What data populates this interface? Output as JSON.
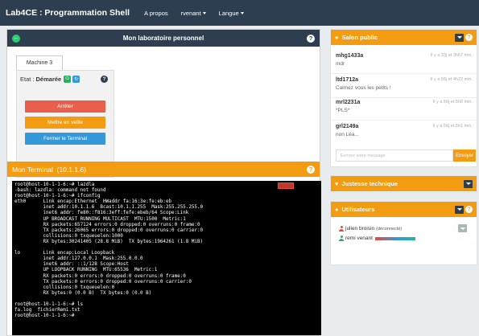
{
  "navbar": {
    "brand": "Lab4CE : Programmation Shell",
    "links": [
      "A propos",
      "rvenant",
      "Langue"
    ]
  },
  "lab": {
    "title": "Mon laboratoire personnel",
    "tab": "Machine 3",
    "state_label": "Etat :",
    "state_value": "Démarée",
    "buttons": {
      "stop": "Arrêter",
      "sleep": "Mettre en veille",
      "close": "Fermer le Terminal"
    },
    "colors": {
      "stop": "#e8604c",
      "sleep": "#f39c12",
      "close": "#3498db",
      "header": "#2c3e50"
    }
  },
  "terminal": {
    "title": "Mon Terminal",
    "ip": "(10.1.1.6)",
    "lines": [
      "root@host-10-1-1-6:~# lazdla",
      "-bash: lazdla: command not found",
      "root@host-10-1-1-6:~# ifconfig",
      "eth0      Link encap:Ethernet  HWaddr fa:16:3e:fe:eb:eb",
      "          inet addr:10.1.1.6  Bcast:10.1.1.255  Mask:255.255.255.0",
      "          inet6 addr: fe80::f816:3eff:fefe:ebeb/64 Scope:Link",
      "          UP BROADCAST RUNNING MULTICAST  MTU:1500  Metric:1",
      "          RX packets:657124 errors:0 dropped:0 overruns:0 frame:0",
      "          TX packets:26065 errors:0 dropped:0 overruns:0 carrier:0",
      "          collisions:0 txqueuelen:1000",
      "          RX bytes:30241405 (28.8 MiB)  TX bytes:1964261 (1.8 MiB)",
      "",
      "lo        Link encap:Local Loopback",
      "          inet addr:127.0.0.1  Mask:255.0.0.0",
      "          inet6 addr: ::1/128 Scope:Host",
      "          UP LOOPBACK RUNNING  MTU:65536  Metric:1",
      "          RX packets:0 errors:0 dropped:0 overruns:0 frame:0",
      "          TX packets:0 errors:0 dropped:0 overruns:0 carrier:0",
      "          collisions:0 txqueuelen:0",
      "          RX bytes:0 (0.0 B)  TX bytes:0 (0.0 B)",
      "",
      "root@host-10-1-1-6:~# ls",
      "fa.log  fichierRemi.txt",
      "root@host-10-1-1-6:~# "
    ]
  },
  "chat": {
    "title": "Salon public",
    "messages": [
      {
        "user": "mhg1433a",
        "time": "Il y a 33j et 3h57 min.",
        "text": "mdr"
      },
      {
        "user": "ltd1712a",
        "time": "Il y a 56j et 4h22 min.",
        "text": "Calmez vous les petits !"
      },
      {
        "user": "mrl2231a",
        "time": "Il y a 56j et 5h0 min.",
        "text": "*PLS*"
      },
      {
        "user": "grl2149a",
        "time": "Il y a 56j et 5h1 min.",
        "text": "non Léa..."
      }
    ],
    "placeholder": "Ecrivez votre message",
    "send": "Envoyer"
  },
  "justesse": {
    "title": "Justesse technique"
  },
  "users": {
    "title": "Utilisateurs",
    "list": [
      {
        "name": "julien broisin",
        "status": "(déconnecté)",
        "color": "#e74c3c"
      },
      {
        "name": "remi venant",
        "status": "",
        "color": "#27ae60"
      }
    ]
  }
}
